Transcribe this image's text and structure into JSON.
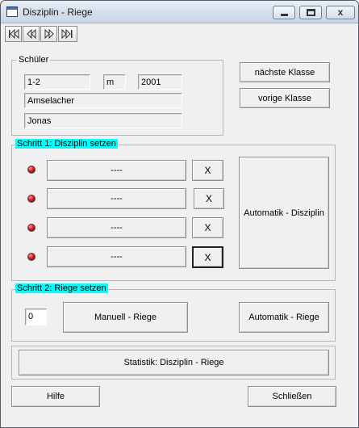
{
  "window": {
    "title": "Disziplin - Riege",
    "min_glyph": "",
    "close_glyph": "x"
  },
  "schueler": {
    "legend": "Schüler",
    "klasse": "1-2",
    "geschlecht": "m",
    "jahrgang": "2001",
    "nachname": "Amselacher",
    "vorname": "Jonas",
    "next_class_label": "nächste Klasse",
    "prev_class_label": "vorige Klasse"
  },
  "schritt1": {
    "legend": "Schritt 1: Disziplin setzen",
    "rows": [
      {
        "value": "----",
        "clear_label": "X"
      },
      {
        "value": "----",
        "clear_label": "X"
      },
      {
        "value": "----",
        "clear_label": "X"
      },
      {
        "value": "----",
        "clear_label": "X"
      }
    ],
    "auto_label": "Automatik - Disziplin"
  },
  "schritt2": {
    "legend": "Schritt 2: Riege setzen",
    "riege_value": "0",
    "manual_label": "Manuell - Riege",
    "auto_label": "Automatik - Riege"
  },
  "statistik_label": "Statistik: Disziplin - Riege",
  "footer": {
    "help_label": "Hilfe",
    "close_label": "Schließen"
  },
  "colors": {
    "legend_highlight": "#00ffff",
    "led_red": "#e0181a",
    "window_bg": "#f0f0f0"
  },
  "icons": [
    "first-record-icon",
    "previous-record-icon",
    "next-record-icon",
    "last-record-icon",
    "red-led-icon"
  ]
}
